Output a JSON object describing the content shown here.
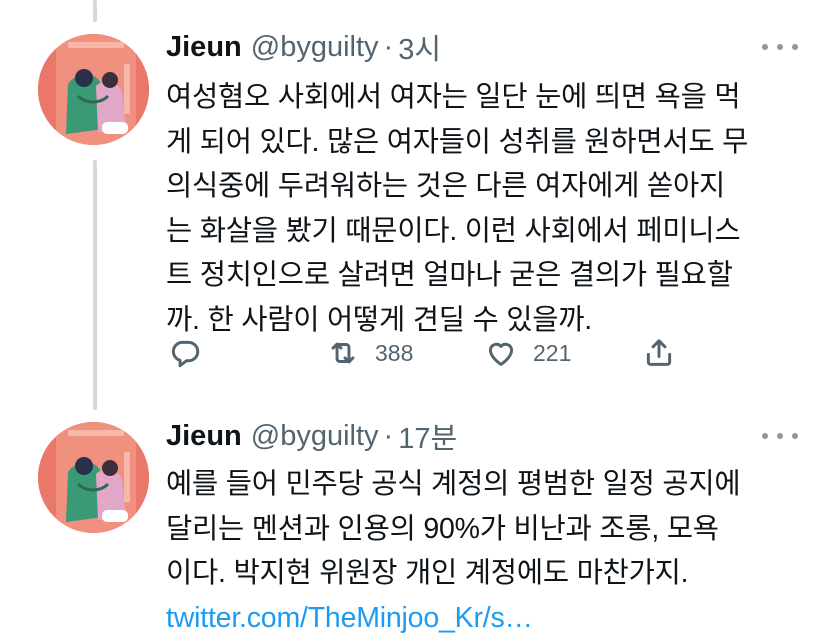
{
  "thread": {
    "tweets": [
      {
        "author_name": "Jieun",
        "handle": "@byguilty",
        "separator": "·",
        "time": "3시",
        "lines": [
          "여성혐오 사회에서 여자는 일단 눈에 띄면 욕을 먹",
          "게 되어 있다. 많은 여자들이 성취를 원하면서도 무",
          "의식중에 두려워하는 것은 다른 여자에게 쏟아지",
          "는 화살을 봤기 때문이다. 이런 사회에서 페미니스",
          "트 정치인으로 살려면 얼마나 굳은 결의가 필요할",
          "까. 한 사람이 어떻게 견딜 수 있을까."
        ],
        "actions": {
          "reply_icon": "reply-icon",
          "retweet_icon": "retweet-icon",
          "retweet_count": "388",
          "like_icon": "heart-icon",
          "like_count": "221",
          "share_icon": "share-icon"
        }
      },
      {
        "author_name": "Jieun",
        "handle": "@byguilty",
        "separator": "·",
        "time": "17분",
        "lines": [
          "예를 들어 민주당 공식 계정의 평범한 일정 공지에",
          "달리는 멘션과 인용의 90%가 비난과 조롱, 모욕",
          "이다. 박지현 위원장 개인 계정에도 마찬가지."
        ],
        "link": "twitter.com/TheMinjoo_Kr/s…"
      }
    ]
  },
  "colors": {
    "link": "#1d9bf0",
    "secondary_text": "#536471",
    "thread_line": "#cfd9de",
    "avatar_cover": "#e9776a"
  }
}
